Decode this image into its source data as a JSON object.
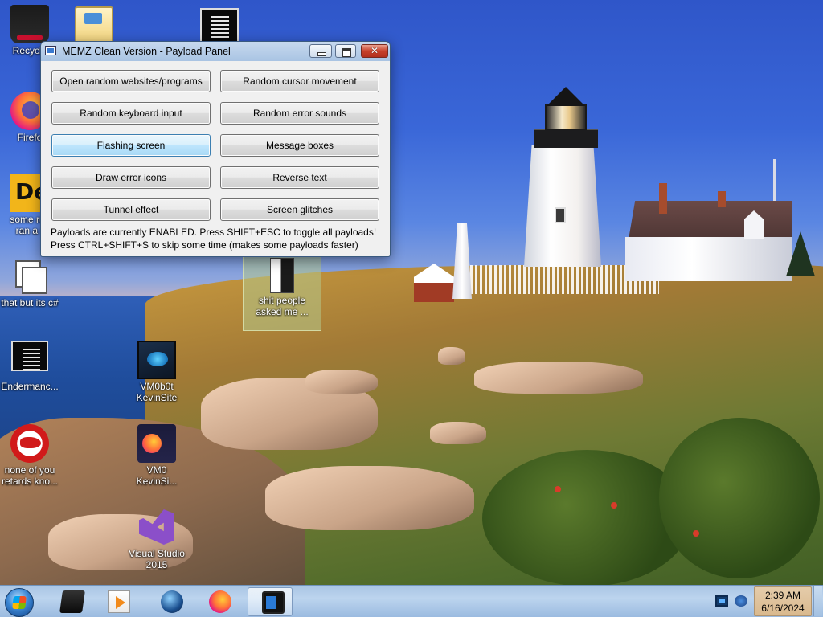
{
  "window": {
    "title": "MEMZ Clean Version - Payload Panel",
    "buttons": [
      {
        "label": "Open random websites/programs",
        "active": false
      },
      {
        "label": "Random cursor movement",
        "active": false
      },
      {
        "label": "Random keyboard input",
        "active": false
      },
      {
        "label": "Random error sounds",
        "active": false
      },
      {
        "label": "Flashing screen",
        "active": true
      },
      {
        "label": "Message boxes",
        "active": false
      },
      {
        "label": "Draw error icons",
        "active": false
      },
      {
        "label": "Reverse text",
        "active": false
      },
      {
        "label": "Tunnel effect",
        "active": false
      },
      {
        "label": "Screen glitches",
        "active": false
      }
    ],
    "status_line_1": "Payloads are currently ENABLED. Press SHIFT+ESC to toggle all payloads!",
    "status_line_2": "Press CTRL+SHIFT+S to skip some time (makes some payloads faster)"
  },
  "desktop_icons": {
    "recycle_bin": {
      "label": "Recycle",
      "icon": "recycle-bin-icon"
    },
    "firefox": {
      "label": "Firefo",
      "icon": "firefox-icon"
    },
    "some_rus": {
      "label_line1": "some rus",
      "label_line2": "ran a r",
      "icon": "dex-app-icon"
    },
    "copy": {
      "label": "that but its c#",
      "icon": "copy-files-icon"
    },
    "enderman": {
      "label": "Endermanc...",
      "icon": "document-icon"
    },
    "none_of_you": {
      "label_line1": "none of you",
      "label_line2": "retards kno...",
      "icon": "red-circle-app-icon"
    },
    "mail": {
      "icon": "mail-icon"
    },
    "doc_top": {
      "icon": "document-icon"
    },
    "shit_people": {
      "label_line1": "shit people",
      "label_line2": "asked me ...",
      "icon": "folder-file-icon"
    },
    "vm0b0t": {
      "label_line1": "VM0b0t",
      "label_line2": "KevinSite",
      "icon": "vm-app-icon"
    },
    "vm0": {
      "label_line1": "VM0",
      "label_line2": "KevinSi...",
      "icon": "firefox-shortcut-icon"
    },
    "visual_studio": {
      "label_line1": "Visual Studio",
      "label_line2": "2015",
      "icon": "visual-studio-icon"
    }
  },
  "taskbar": {
    "start_icon": "windows-start-icon",
    "items": [
      {
        "icon": "black-app-icon",
        "active": false
      },
      {
        "icon": "media-player-icon",
        "active": false
      },
      {
        "icon": "globe-icon",
        "active": false
      },
      {
        "icon": "firefox-icon",
        "active": false
      },
      {
        "icon": "memz-app-icon",
        "active": true
      }
    ],
    "tray": [
      "network-icon",
      "volume-icon"
    ],
    "clock_time": "2:39 AM",
    "clock_date": "6/16/2024"
  },
  "colors": {
    "active_button": "#bee6fd",
    "taskbar": "#bcd4ee",
    "clock_bg": "#e5ccaa"
  }
}
